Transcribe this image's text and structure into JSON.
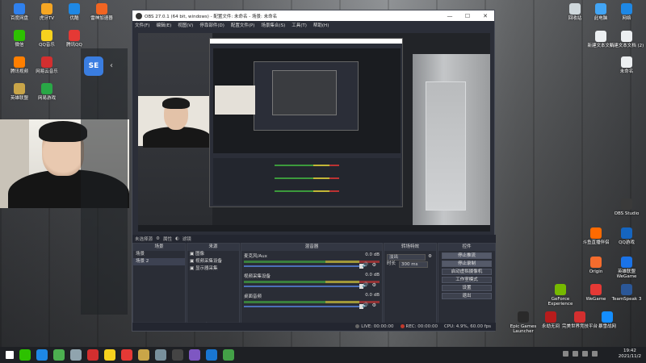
{
  "desktop": {
    "left_icons": [
      {
        "label": "百度网盘",
        "color": "#2f80ed"
      },
      {
        "label": "虎牙TV",
        "color": "#f5a623"
      },
      {
        "label": "优酷",
        "color": "#1e88e5"
      },
      {
        "label": "雷神加速器",
        "color": "#f26522"
      },
      {
        "label": "微信",
        "color": "#2dc100"
      },
      {
        "label": "QQ音乐",
        "color": "#f7d21e"
      },
      {
        "label": "腾讯QQ",
        "color": "#e53935"
      },
      {
        "label": "腾讯视频",
        "color": "#ff7f00"
      },
      {
        "label": "网易云音乐",
        "color": "#d32f2f"
      },
      {
        "label": "英雄联盟",
        "color": "#c9a548"
      },
      {
        "label": "网易游戏",
        "color": "#29a746"
      }
    ],
    "right_icons": [
      {
        "label": "回收站",
        "color": "#cfd8dc"
      },
      {
        "label": "此电脑",
        "color": "#42a5f5"
      },
      {
        "label": "网络",
        "color": "#1e88e5"
      },
      {
        "label": "新建文本文档",
        "color": "#eceff1"
      },
      {
        "label": "新建文本文档 (2)",
        "color": "#eceff1"
      },
      {
        "label": "未命名",
        "color": "#eceff1"
      },
      {
        "label": "OBS Studio",
        "color": "#3a3a3a"
      },
      {
        "label": "斗鱼直播伴侣",
        "color": "#ff6a00"
      },
      {
        "label": "QQ游戏",
        "color": "#1565c0"
      },
      {
        "label": "Origin",
        "color": "#f56c2d"
      },
      {
        "label": "英雄联盟WeGame",
        "color": "#1a73e8"
      },
      {
        "label": "GeForce Experience",
        "color": "#76b900"
      },
      {
        "label": "WeGame",
        "color": "#e53935"
      },
      {
        "label": "TeamSpeak 3",
        "color": "#2b5797"
      },
      {
        "label": "Epic Games Launcher",
        "color": "#2a2a2a"
      },
      {
        "label": "永劫无间",
        "color": "#b71c1c"
      },
      {
        "label": "完美世界竞技平台",
        "color": "#d32f2f"
      },
      {
        "label": "暴雪战网",
        "color": "#148eff"
      }
    ]
  },
  "side_panel": {
    "app_badge": "SE"
  },
  "obs": {
    "title": "OBS 27.0.1 (64 bit, windows) - 配置文件: 未命名 - 场景: 未命名",
    "window_controls": [
      "—",
      "☐",
      "✕"
    ],
    "menu": [
      "文件(F)",
      "编辑(E)",
      "视图(V)",
      "停靠部件(D)",
      "配置文件(P)",
      "场景集合(S)",
      "工具(T)",
      "帮助(H)"
    ],
    "source_bar": {
      "label": "未选择源",
      "props": "属性",
      "filters": "滤镜"
    },
    "scenes": {
      "header": "场景",
      "items": [
        "场景",
        "场景 2"
      ]
    },
    "sources": {
      "header": "来源",
      "items": [
        "图像",
        "视频采集设备",
        "显示器采集"
      ]
    },
    "mixer": {
      "header": "混音器",
      "channels": [
        {
          "name": "麦克风/Aux",
          "db": "0.0 dB"
        },
        {
          "name": "视频采集设备",
          "db": "0.0 dB"
        },
        {
          "name": "桌面音频",
          "db": "0.0 dB"
        }
      ]
    },
    "transitions": {
      "header": "转场特效",
      "type": "淡出",
      "duration_label": "时长",
      "duration": "300 ms"
    },
    "controls": {
      "header": "控件",
      "buttons": [
        "停止推流",
        "停止录制",
        "启动虚拟摄像机",
        "工作室模式",
        "设置",
        "退出"
      ]
    },
    "status": {
      "live": "LIVE: 00:00:00",
      "rec": "REC: 00:00:00",
      "cpu": "CPU: 4.9%, 60.00 fps"
    }
  },
  "taskbar": {
    "apps": [
      {
        "name": "start",
        "color": "#ffffff"
      },
      {
        "name": "wechat",
        "color": "#2dc100"
      },
      {
        "name": "qq",
        "color": "#1e88e5"
      },
      {
        "name": "chrome",
        "color": "#4caf50"
      },
      {
        "name": "steam",
        "color": "#90a4ae"
      },
      {
        "name": "netease-music",
        "color": "#d32f2f"
      },
      {
        "name": "qq-music",
        "color": "#f7d21e"
      },
      {
        "name": "game",
        "color": "#e53935"
      },
      {
        "name": "lol",
        "color": "#c9a548"
      },
      {
        "name": "steam-2",
        "color": "#78909c"
      },
      {
        "name": "obs",
        "color": "#444444"
      },
      {
        "name": "app-purple",
        "color": "#7e57c2"
      },
      {
        "name": "app-blue",
        "color": "#1976d2"
      },
      {
        "name": "app-green",
        "color": "#43a047"
      }
    ],
    "time": "19:42",
    "date": "2021/11/2"
  }
}
